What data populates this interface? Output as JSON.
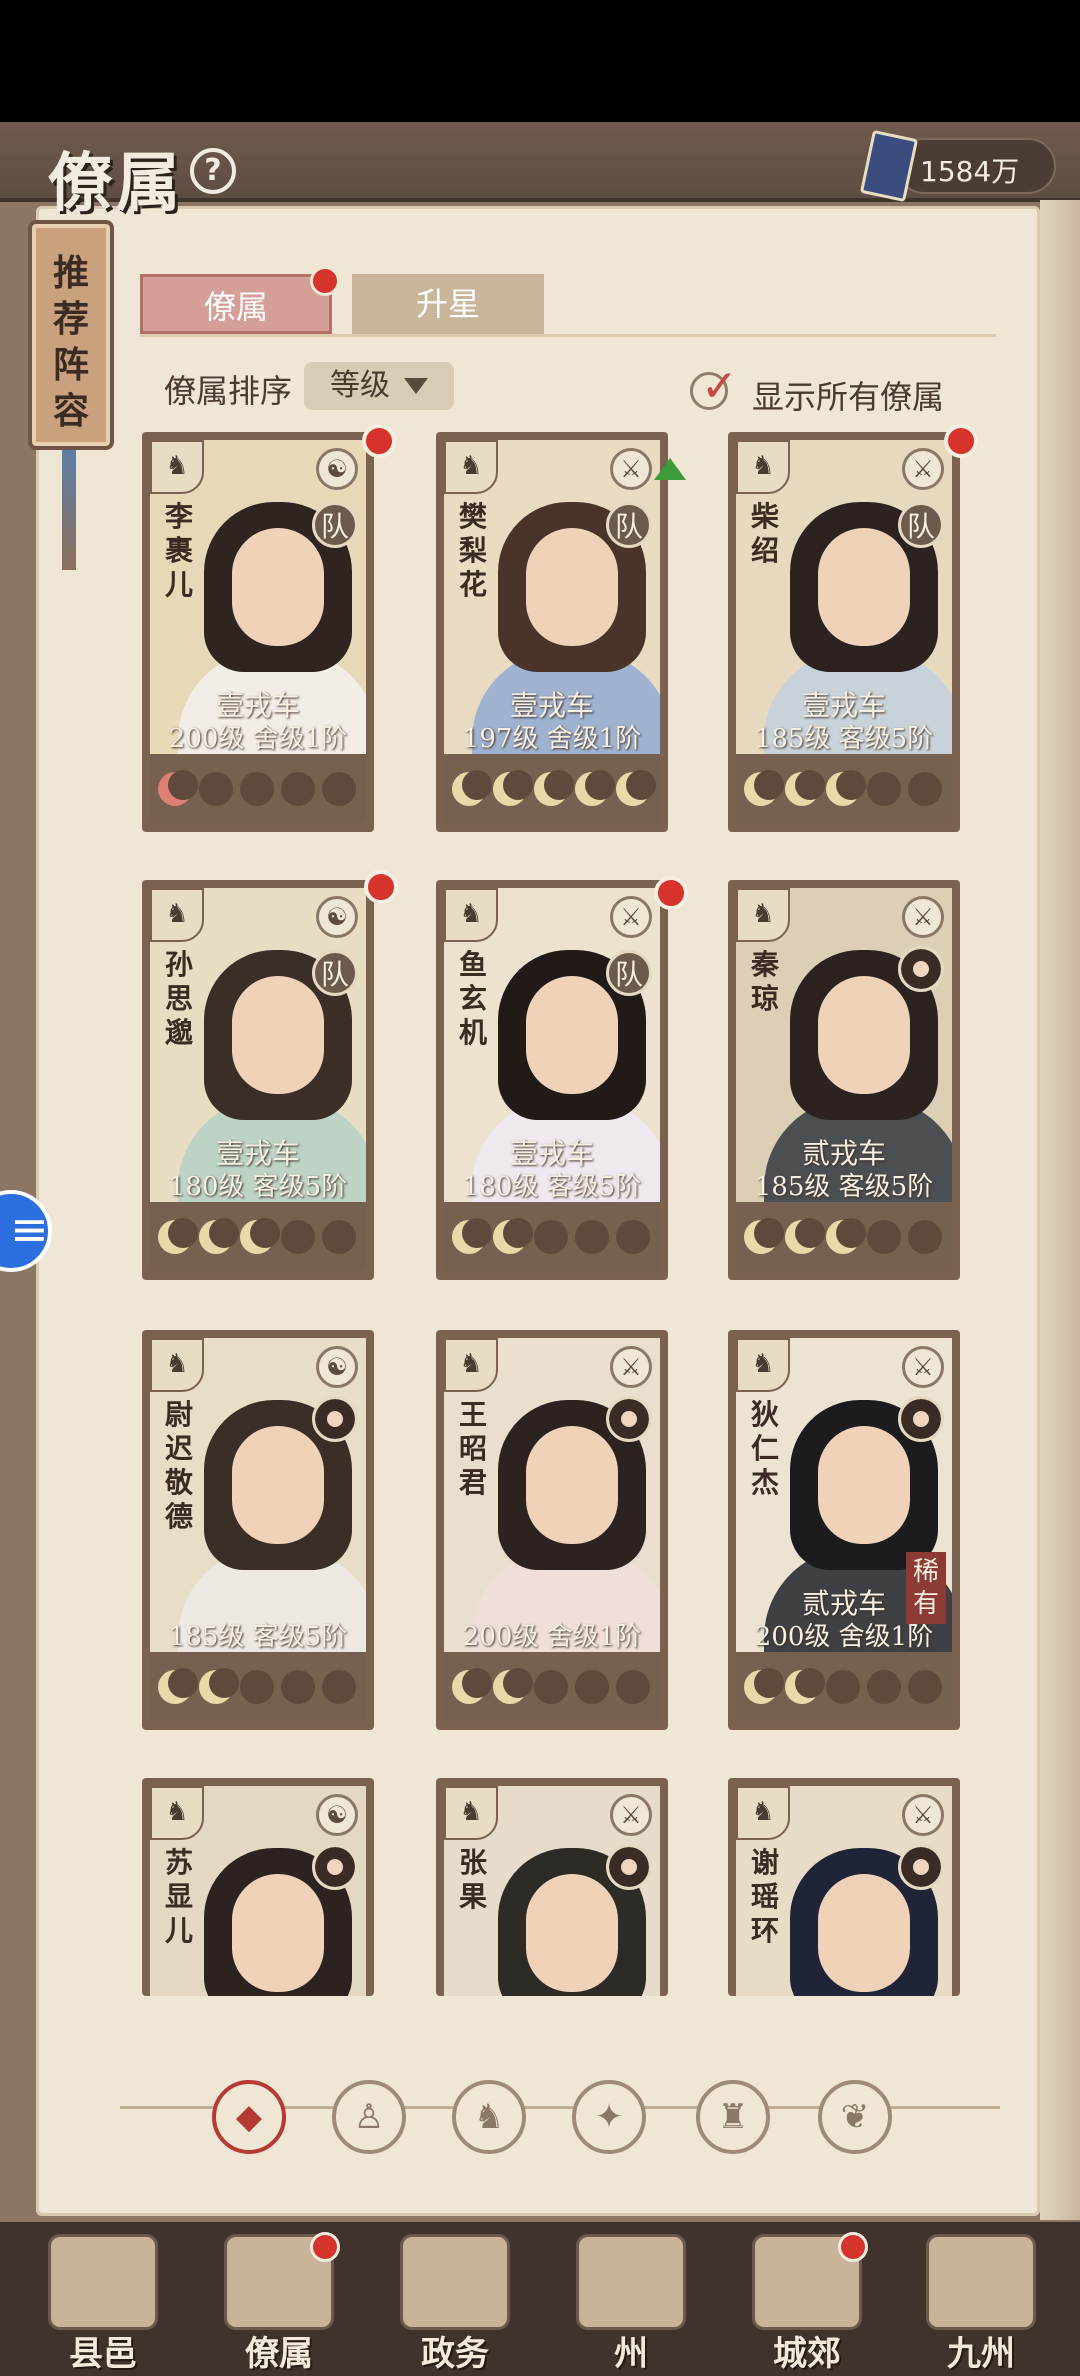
{
  "header": {
    "title": "僚属",
    "help": "?",
    "currency_value": "1584万"
  },
  "recommend": {
    "label": "推荐阵容"
  },
  "tabs": [
    {
      "label": "僚属"
    },
    {
      "label": "升星"
    }
  ],
  "sort": {
    "label": "僚属排序",
    "value": "等级"
  },
  "show_all": {
    "label": "显示所有僚属",
    "checked": true
  },
  "cards": [
    {
      "name": "李裹儿",
      "vehicle": "壹戎车",
      "level": "200级 舍级1阶",
      "moons": 1
    },
    {
      "name": "樊梨花",
      "vehicle": "壹戎车",
      "level": "197级 舍级1阶",
      "moons": 5
    },
    {
      "name": "柴绍",
      "vehicle": "壹戎车",
      "level": "185级 客级5阶",
      "moons": 3
    },
    {
      "name": "孙思邈",
      "vehicle": "壹戎车",
      "level": "180级 客级5阶",
      "moons": 3
    },
    {
      "name": "鱼玄机",
      "vehicle": "壹戎车",
      "level": "180级 客级5阶",
      "moons": 2
    },
    {
      "name": "秦琼",
      "vehicle": "贰戎车",
      "level": "185级 客级5阶",
      "moons": 3
    },
    {
      "name": "尉迟敬德",
      "vehicle": "",
      "level": "185级 客级5阶",
      "moons": 2
    },
    {
      "name": "王昭君",
      "vehicle": "",
      "level": "200级 舍级1阶",
      "moons": 2
    },
    {
      "name": "狄仁杰",
      "vehicle": "贰戎车",
      "level": "200级 舍级1阶",
      "moons": 2,
      "rare": "稀有"
    },
    {
      "name": "苏显儿",
      "vehicle": "",
      "level": "",
      "moons": 0
    },
    {
      "name": "张果",
      "vehicle": "",
      "level": "",
      "moons": 0
    },
    {
      "name": "谢瑶环",
      "vehicle": "",
      "level": "",
      "moons": 0
    }
  ],
  "badges": {
    "dui": "队"
  },
  "nav": [
    {
      "label": "县邑"
    },
    {
      "label": "僚属"
    },
    {
      "label": "政务"
    },
    {
      "label": "州"
    },
    {
      "label": "城郊"
    },
    {
      "label": "九州"
    }
  ]
}
